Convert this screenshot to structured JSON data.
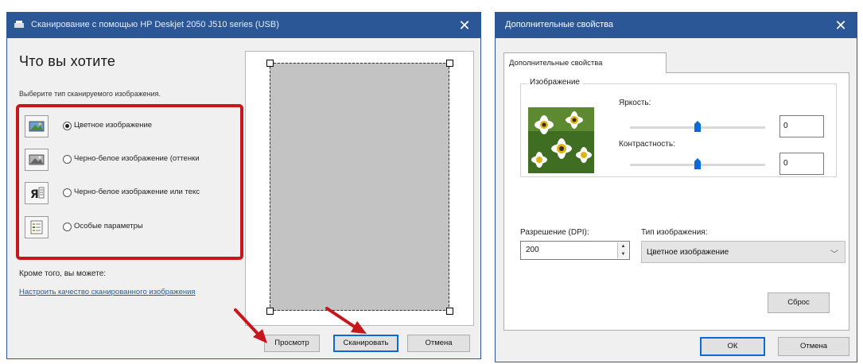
{
  "scan_window": {
    "title": "Сканирование с помощью HP Deskjet 2050 J510 series (USB)",
    "heading": "Что вы хотите",
    "subheading": "Выберите тип сканируемого изображения.",
    "options": [
      {
        "label": "Цветное изображение",
        "checked": true,
        "icon": "color-photo-icon"
      },
      {
        "label": "Черно-белое изображение (оттенки",
        "checked": false,
        "icon": "grayscale-photo-icon"
      },
      {
        "label": "Черно-белое изображение или текс",
        "checked": false,
        "icon": "text-document-icon"
      },
      {
        "label": "Особые параметры",
        "checked": false,
        "icon": "custom-settings-icon"
      }
    ],
    "also_label": "Кроме того, вы можете:",
    "adjust_link": "Настроить качество сканированного изображения",
    "buttons": {
      "preview": "Просмотр",
      "scan": "Сканировать",
      "cancel": "Отмена"
    }
  },
  "properties_window": {
    "title": "Дополнительные свойства",
    "tab_label": "Дополнительные свойства",
    "group_label": "Изображение",
    "brightness_label": "Яркость:",
    "brightness_value": "0",
    "brightness_level": 0.5,
    "contrast_label": "Контрастность:",
    "contrast_value": "0",
    "contrast_level": 0.5,
    "resolution_label": "Разрешение (DPI):",
    "resolution_value": "200",
    "image_type_label": "Тип изображения:",
    "image_type_value": "Цветное изображение",
    "reset_button": "Сброс",
    "ok_button": "ОК",
    "cancel_button": "Отмена"
  },
  "colors": {
    "titlebar": "#2b5797",
    "highlight_box": "#c8161d",
    "arrow": "#c8161d",
    "link": "#1a5fb4",
    "slider_thumb": "#0b6ad6"
  }
}
